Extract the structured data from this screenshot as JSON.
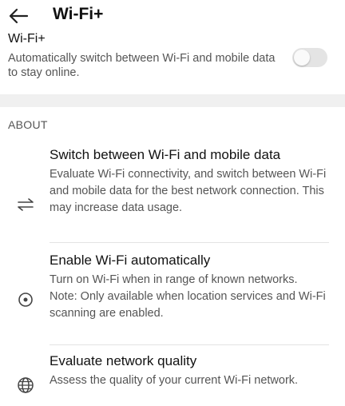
{
  "header": {
    "title": "Wi-Fi+"
  },
  "wifi_plus": {
    "label": "Wi-Fi+",
    "description": "Automatically switch between Wi-Fi and mobile data to stay online.",
    "enabled": false
  },
  "about": {
    "header": "ABOUT",
    "items": [
      {
        "title": "Switch between Wi-Fi and mobile data",
        "description": "Evaluate Wi-Fi connectivity, and switch between Wi-Fi and mobile data for the best network connection. This may increase data usage.",
        "icon": "swap-arrows-icon"
      },
      {
        "title": "Enable Wi-Fi automatically",
        "description": "Turn on Wi-Fi when in range of known networks.",
        "note": "Note: Only available when location services and Wi-Fi scanning are enabled.",
        "icon": "location-target-icon"
      },
      {
        "title": "Evaluate network quality",
        "description": "Assess the quality of your current Wi-Fi network.",
        "icon": "globe-icon"
      }
    ]
  },
  "colors": {
    "toggle_off": "#e4e4e4",
    "band": "#f0f0f0",
    "secondary_text": "#555555"
  }
}
